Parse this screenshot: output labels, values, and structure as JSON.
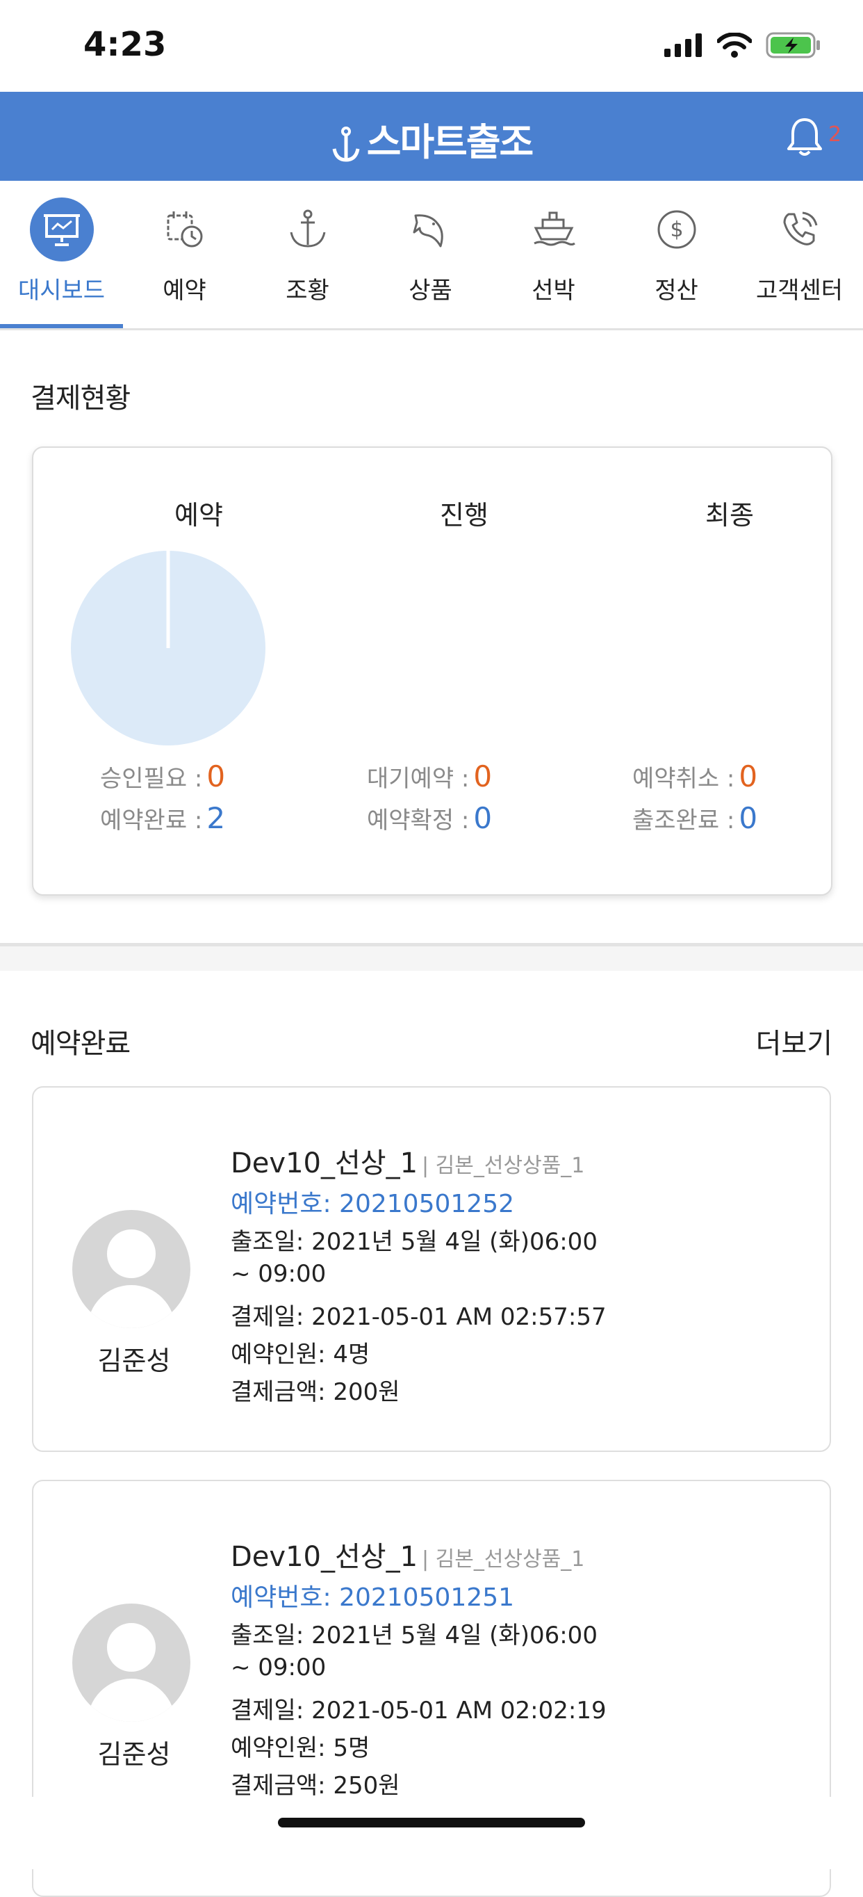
{
  "status_bar": {
    "time": "4:23"
  },
  "header": {
    "logo": "스마트출조",
    "notification_count": "2"
  },
  "nav": [
    {
      "label": "대시보드",
      "icon": "dashboard-icon",
      "active": true
    },
    {
      "label": "예약",
      "icon": "calendar-clock-icon"
    },
    {
      "label": "조황",
      "icon": "anchor-icon"
    },
    {
      "label": "상품",
      "icon": "fish-icon"
    },
    {
      "label": "선박",
      "icon": "ship-icon"
    },
    {
      "label": "정산",
      "icon": "dollar-icon"
    },
    {
      "label": "고객센터",
      "icon": "phone-icon"
    }
  ],
  "payment_status": {
    "title": "결제현황",
    "columns": [
      "예약",
      "진행",
      "최종"
    ],
    "stats": [
      {
        "label": "승인필요",
        "value": "0"
      },
      {
        "label": "예약완료",
        "value": "2"
      },
      {
        "label": "대기예약",
        "value": "0"
      },
      {
        "label": "예약확정",
        "value": "0"
      },
      {
        "label": "예약취소",
        "value": "0"
      },
      {
        "label": "출조완료",
        "value": "0"
      }
    ],
    "sep": " :"
  },
  "chart_data": {
    "type": "pie",
    "categories": [
      "승인필요",
      "예약완료"
    ],
    "values": [
      0,
      2
    ],
    "colors": [
      "#dceaf8",
      "#dceaf8"
    ]
  },
  "completed": {
    "title": "예약완료",
    "more": "더보기",
    "items": [
      {
        "name": "김준성",
        "title": "Dev10_선상_1",
        "sub": "| 김본_선상상품_1",
        "booking_no": "예약번호: 20210501252",
        "date": "출조일: 2021년 5월 4일 (화)06:00",
        "time": "~ 09:00",
        "paid_at": "결제일: 2021-05-01 AM 02:57:57",
        "people": "예약인원: 4명",
        "amount": "결제금액: 200원"
      },
      {
        "name": "김준성",
        "title": "Dev10_선상_1",
        "sub": "| 김본_선상상품_1",
        "booking_no": "예약번호: 20210501251",
        "date": "출조일: 2021년 5월 4일 (화)06:00",
        "time": "~ 09:00",
        "paid_at": "결제일: 2021-05-01 AM 02:02:19",
        "people": "예약인원: 5명",
        "amount": "결제금액: 250원"
      }
    ]
  }
}
